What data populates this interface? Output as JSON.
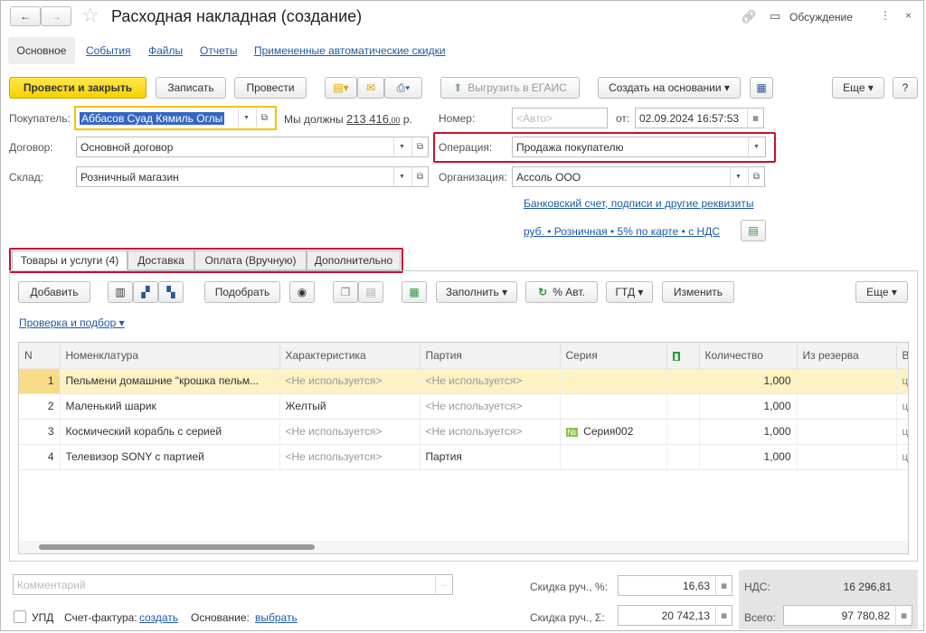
{
  "title": "Расходная накладная (создание)",
  "header": {
    "discussion": "Обсуждение"
  },
  "nav_tabs": [
    "Основное",
    "События",
    "Файлы",
    "Отчеты",
    "Примененные автоматические скидки"
  ],
  "toolbar": {
    "post_close": "Провести и закрыть",
    "save": "Записать",
    "post": "Провести",
    "egais": "Выгрузить в ЕГАИС",
    "create_based": "Создать на основании",
    "more": "Еще",
    "help": "?"
  },
  "form": {
    "buyer_label": "Покупатель:",
    "buyer": "Аббасов Суад Кямиль Оглы",
    "debt_label": "Мы должны",
    "debt_int": "213 416",
    "debt_frac": ",00",
    "debt_cur": "р.",
    "number_label": "Номер:",
    "number_placeholder": "<Авто>",
    "date_label": "от:",
    "date": "02.09.2024 16:57:53",
    "contract_label": "Договор:",
    "contract": "Основной договор",
    "operation_label": "Операция:",
    "operation": "Продажа покупателю",
    "warehouse_label": "Склад:",
    "warehouse": "Розничный магазин",
    "org_label": "Организация:",
    "org": "Ассоль ООО",
    "bank_link": "Банковский счет, подписи и другие реквизиты",
    "price_link": "руб. • Розничная • 5% по карте • с НДС"
  },
  "doc_tabs": [
    "Товары и услуги (4)",
    "Доставка",
    "Оплата (Вручную)",
    "Дополнительно"
  ],
  "table_toolbar": {
    "add": "Добавить",
    "pick": "Подобрать",
    "fill": "Заполнить",
    "auto": "% Авт.",
    "gtd": "ГТД",
    "change": "Изменить",
    "more": "Еще"
  },
  "check_link": "Проверка и подбор",
  "columns": [
    "N",
    "Номенклатура",
    "Характеристика",
    "Партия",
    "Серия",
    "",
    "Количество",
    "Из резерва",
    "В"
  ],
  "rows": [
    {
      "n": "1",
      "name": "Пельмени домашние \"крошка пельм...",
      "char": "<Не используется>",
      "batch": "<Не используется>",
      "series": "",
      "qty": "1,000"
    },
    {
      "n": "2",
      "name": "Маленький шарик",
      "char": "Желтый",
      "batch": "<Не используется>",
      "series": "",
      "qty": "1,000"
    },
    {
      "n": "3",
      "name": "Космический корабль с серией",
      "char": "<Не используется>",
      "batch": "<Не используется>",
      "series": "Серия002",
      "qty": "1,000"
    },
    {
      "n": "4",
      "name": "Телевизор SONY с партией",
      "char": "<Не используется>",
      "batch": "Партия",
      "series": "",
      "qty": "1,000"
    }
  ],
  "footer": {
    "comment_placeholder": "Комментарий",
    "upd": "УПД",
    "invoice_label": "Счет-фактура:",
    "invoice_link": "создать",
    "basis_label": "Основание:",
    "basis_link": "выбрать",
    "disc_pct_label": "Скидка руч., %:",
    "disc_pct": "16,63",
    "disc_sum_label": "Скидка руч., Σ:",
    "disc_sum": "20 742,13",
    "vat_label": "НДС:",
    "vat": "16 296,81",
    "total_label": "Всего:",
    "total": "97 780,82"
  },
  "colors": {
    "accent_yellow": "#f6d100",
    "highlight_red": "#c8102e",
    "link": "#1f5ba8",
    "selected_row": "#fdf2c4"
  }
}
